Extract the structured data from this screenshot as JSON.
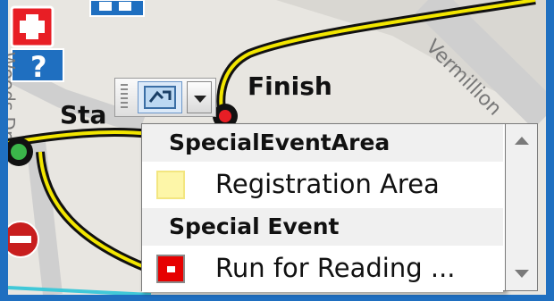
{
  "map": {
    "labels": {
      "finish": "Finish",
      "start": "Sta",
      "street_vermillion": "Vermillion",
      "street_woods": "Woods Dr"
    }
  },
  "symbol_picker": {
    "icon": "symbol-swatch-icon",
    "dropdown_icon": "chevron-down-icon"
  },
  "dropdown": {
    "groups": [
      {
        "header": "SpecialEventArea",
        "items": [
          {
            "label": "Registration Area",
            "color": "#fdf6a8"
          }
        ]
      },
      {
        "header": "Special Event",
        "items": [
          {
            "label": "Run for Reading ...",
            "color": "#e60000"
          }
        ]
      }
    ]
  }
}
